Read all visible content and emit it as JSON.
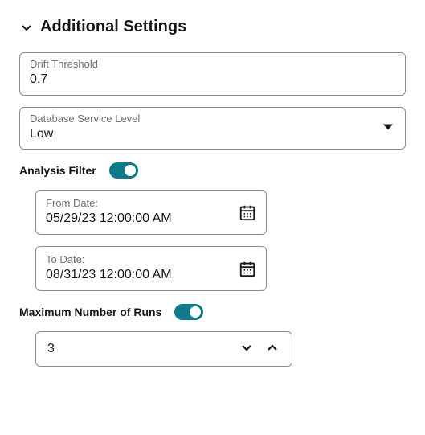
{
  "section": {
    "title": "Additional Settings"
  },
  "driftThreshold": {
    "label": "Drift Threshold",
    "value": "0.7"
  },
  "dbServiceLevel": {
    "label": "Database Service Level",
    "value": "Low"
  },
  "analysisFilter": {
    "label": "Analysis Filter",
    "enabled": true
  },
  "fromDate": {
    "label": "From Date:",
    "value": "05/29/23 12:00:00 AM"
  },
  "toDate": {
    "label": "To Date:",
    "value": "08/31/23 12:00:00 AM"
  },
  "maxRuns": {
    "label": "Maximum Number of Runs",
    "enabled": true,
    "value": "3"
  }
}
